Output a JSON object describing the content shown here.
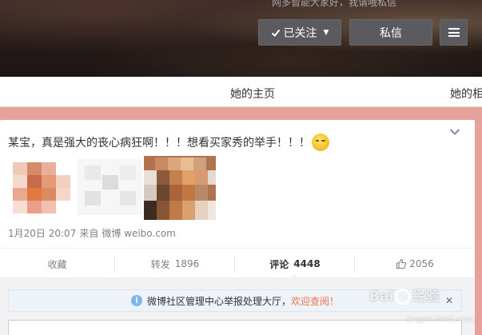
{
  "banner": {
    "text": "网多智能大家好，我请哦私信"
  },
  "header": {
    "follow_label": "已关注",
    "message_label": "私信"
  },
  "nav": {
    "tabs": [
      {
        "label": "她的主页"
      },
      {
        "label": "她的相"
      }
    ]
  },
  "post": {
    "text": "某宝，真是强大的丧心病狂啊！！！想看买家秀的举手！！！",
    "date": "1月20日 20:07",
    "via": "来自",
    "source": "微博 weibo.com",
    "images_blurred": true
  },
  "actions": {
    "favorite_label": "收藏",
    "forward_label": "转发",
    "forward_count": "1896",
    "comment_label": "评论",
    "comment_count": "4448",
    "like_count": "2056"
  },
  "notice": {
    "text": "微博社区管理中心举报处理大厅，",
    "link": "欢迎查阅！",
    "close": "✕"
  },
  "watermark": {
    "brand": "Bai",
    "brand_end": "经验",
    "sub": "jingyan.baidu.com"
  },
  "colors": {
    "page_bg": "#e7a19b",
    "button_bg": "#5b5b5f",
    "link": "#eb7350",
    "notice_bg": "#eef3f9"
  }
}
